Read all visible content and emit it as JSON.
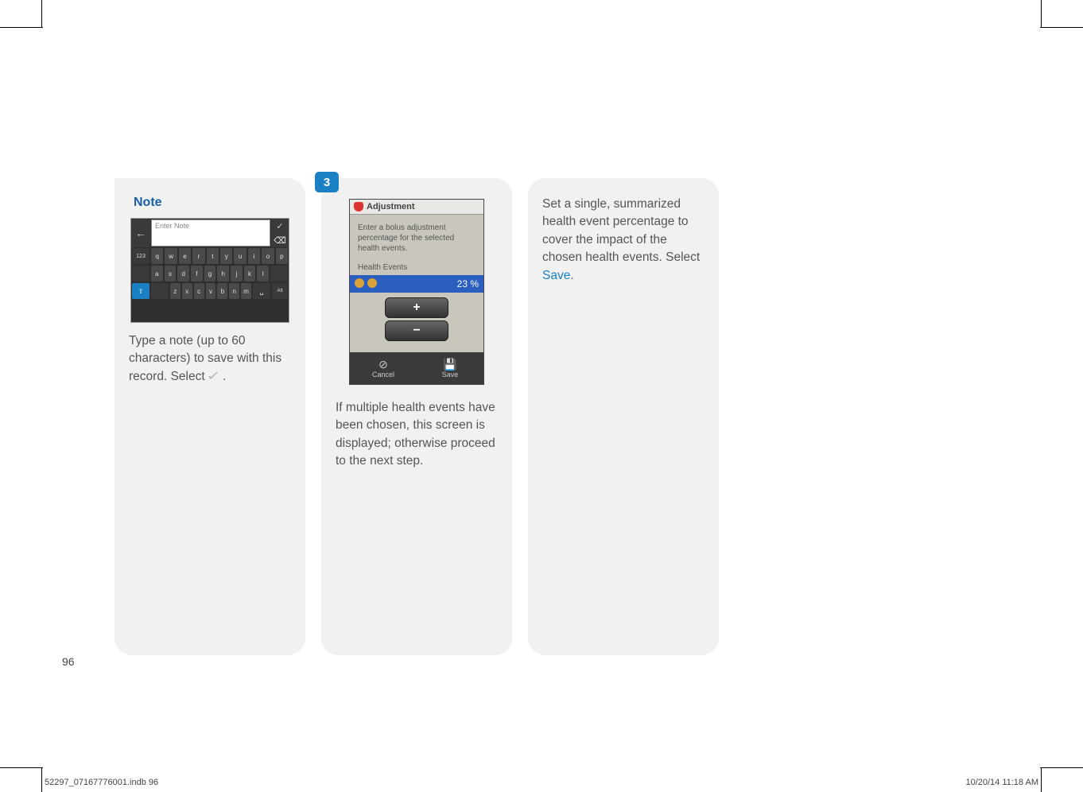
{
  "page_number": "96",
  "footer": {
    "left": "52297_07167776001.indb   96",
    "right": "10/20/14   11:18 AM"
  },
  "card1": {
    "title": "Note",
    "keyboard": {
      "placeholder": "Enter Note",
      "num_key": "123",
      "row1": [
        "q",
        "w",
        "e",
        "r",
        "t",
        "y",
        "u",
        "i",
        "o",
        "p"
      ],
      "row2": [
        "a",
        "s",
        "d",
        "f",
        "g",
        "h",
        "j",
        "k",
        "l"
      ],
      "row3": [
        "z",
        "x",
        "c",
        "v",
        "b",
        "n",
        "m"
      ],
      "alt_key": "Alt"
    },
    "caption_before_icon": "Type a note (up to 60 characters) to save with this record. Select ",
    "caption_after_icon": "."
  },
  "card2": {
    "step": "3",
    "titlebar": "Adjustment",
    "instruction": "Enter a bolus adjustment percentage for the selected health events.",
    "section_label": "Health Events",
    "value": "23 %",
    "cancel_label": "Cancel",
    "save_label": "Save",
    "caption": "If multiple health events have been chosen, this screen is displayed; otherwise proceed to the next step."
  },
  "card3": {
    "caption_before": "Set a single, summarized health event percentage to cover the impact of the chosen health events. Select ",
    "save_word": "Save",
    "caption_after": "."
  }
}
